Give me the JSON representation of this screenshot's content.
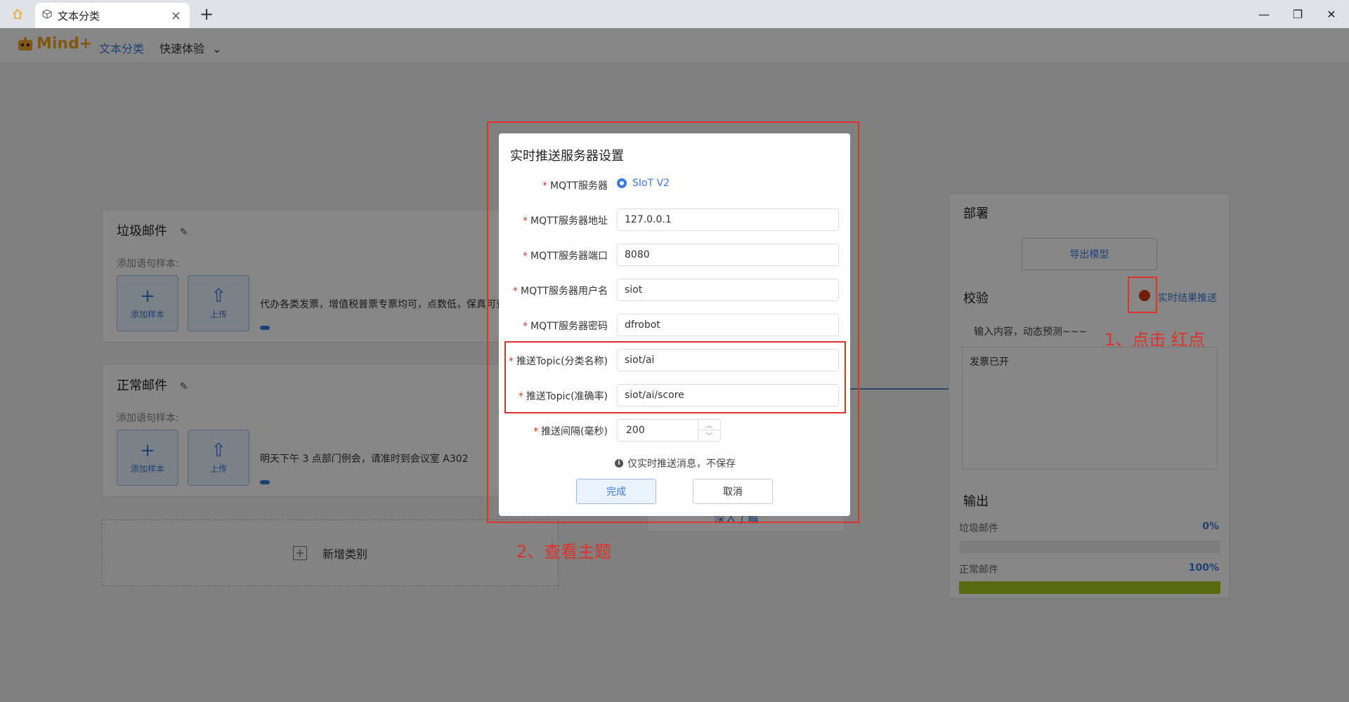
{
  "titlebar": {
    "tab_label": "文本分类",
    "close_glyph": "×",
    "new_tab_glyph": "+",
    "minimize_glyph": "—",
    "restore_glyph": "❐",
    "window_close_glyph": "✕"
  },
  "header": {
    "logo_text": "Mind+",
    "nav_active": "文本分类",
    "nav_quick": "快速体验",
    "nav_quick_caret": "⌄"
  },
  "categories": [
    {
      "title": "垃圾邮件",
      "sub": "添加语句样本:",
      "add_label": "添加样本",
      "upload_label": "上传",
      "sample": "代办各类发票，增值税普票专票均可，点数低，保真可查"
    },
    {
      "title": "正常邮件",
      "sub": "添加语句样本:",
      "add_label": "添加样本",
      "upload_label": "上传",
      "sample": "明天下午 3 点部门例会，请准时到会议室 A302"
    }
  ],
  "add_category": "新增类别",
  "middle": {
    "learn_more": "深入了解"
  },
  "deploy": {
    "title": "部署",
    "export": "导出模型"
  },
  "verify": {
    "title": "校验",
    "push_link": "实时结果推送",
    "hint": "输入内容，动态预测~~~",
    "input_value": "发票已开"
  },
  "output": {
    "title": "输出",
    "rows": [
      {
        "label": "垃圾邮件",
        "pct_text": "0%",
        "fraction": 0
      },
      {
        "label": "正常邮件",
        "pct_text": "100%",
        "fraction": 1
      }
    ]
  },
  "dialog": {
    "title": "实时推送服务器设置",
    "mqtt_server_label": "MQTT服务器",
    "mqtt_server_option": "SIoT V2",
    "addr_label": "MQTT服务器地址",
    "addr_value": "127.0.0.1",
    "port_label": "MQTT服务器端口",
    "port_value": "8080",
    "user_label": "MQTT服务器用户名",
    "user_value": "siot",
    "pass_label": "MQTT服务器密码",
    "pass_value": "dfrobot",
    "topic_class_label": "推送Topic(分类名称)",
    "topic_class_value": "siot/ai",
    "topic_score_label": "推送Topic(准确率)",
    "topic_score_value": "siot/ai/score",
    "interval_label": "推送间隔(毫秒)",
    "interval_value": "200",
    "note": "仅实时推送消息，不保存",
    "ok": "完成",
    "cancel": "取消"
  },
  "annotations": {
    "step1": "1、点击 红点",
    "step2": "2、查看主题"
  },
  "colors": {
    "accent": "#3a7cd9",
    "annotation_red": "#e0302a",
    "output_bar": "#a8c81f"
  }
}
